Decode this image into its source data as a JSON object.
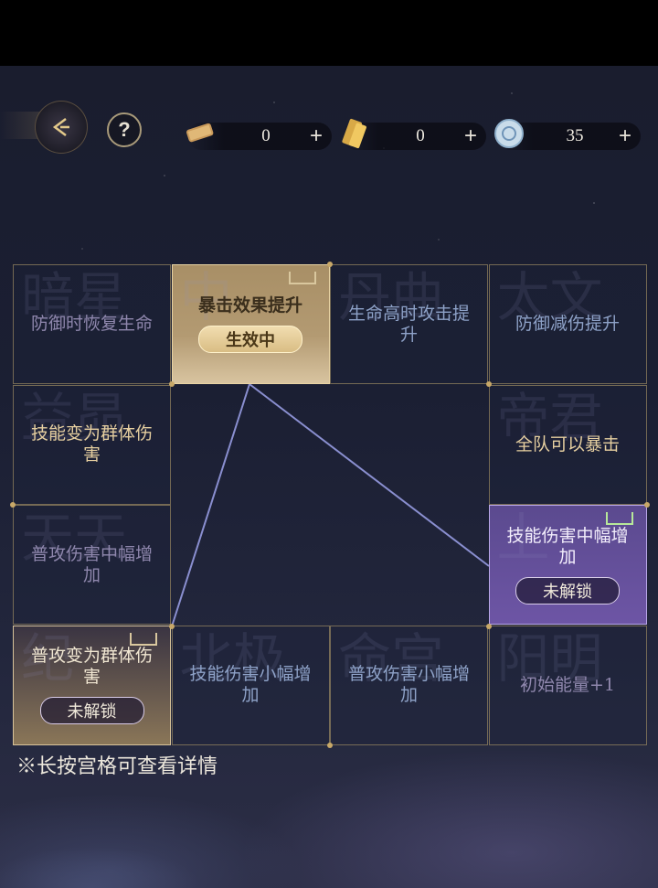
{
  "resources": [
    {
      "icon": "scroll-icon",
      "value": "0",
      "plus": "+"
    },
    {
      "icon": "ticket-icon",
      "value": "0",
      "plus": "+"
    },
    {
      "icon": "coin-icon",
      "value": "35",
      "plus": "+"
    }
  ],
  "help": "?",
  "cells": [
    {
      "label": "防御时恢复生命",
      "bg": "暗星",
      "style": "dim"
    },
    {
      "label": "暴击效果提升",
      "bg": "中",
      "style": "active",
      "badge": "生效中"
    },
    {
      "label": "生命高时攻击提升",
      "bg": "丹曲",
      "style": "dim-blue"
    },
    {
      "label": "防御减伤提升",
      "bg": "太文",
      "style": "dim-blue"
    },
    {
      "label": "技能变为群体伤害",
      "bg": "益昴",
      "style": "gold"
    },
    {
      "label": "全队可以暴击",
      "bg": "帝君",
      "style": "gold"
    },
    {
      "label": "普攻伤害中幅增加",
      "bg": "天天",
      "style": "dim"
    },
    {
      "label": "技能伤害中幅增加",
      "bg": "上",
      "style": "purple",
      "badge": "未解锁"
    },
    {
      "label": "普攻变为群体伤害",
      "bg": "纪",
      "style": "sand",
      "badge": "未解锁"
    },
    {
      "label": "技能伤害小幅增加",
      "bg": "北极",
      "style": "dim-blue"
    },
    {
      "label": "普攻伤害小幅增加",
      "bg": "命宫",
      "style": "dim-blue"
    },
    {
      "label": "初始能量+1",
      "bg": "阳明",
      "style": "dim"
    }
  ],
  "hint": "※长按宫格可查看详情",
  "colors": {
    "gold": "#c8a868",
    "line": "#8a8fd0",
    "purple": "#6d55a5"
  }
}
